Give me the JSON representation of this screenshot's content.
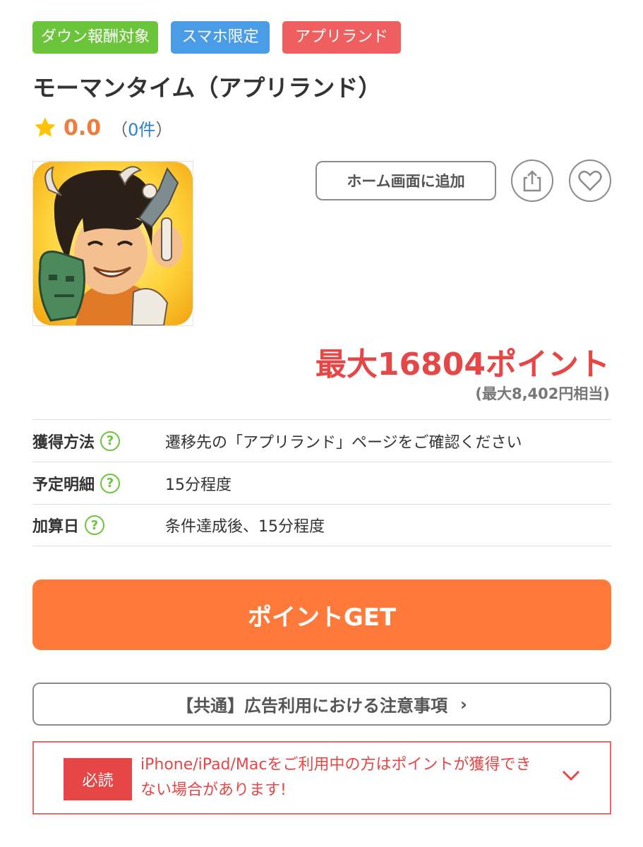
{
  "tags": [
    {
      "label": "ダウン報酬対象",
      "color": "#6bc53b"
    },
    {
      "label": "スマホ限定",
      "color": "#4a9ce6"
    },
    {
      "label": "アプリランド",
      "color": "#ef5f5f"
    }
  ],
  "title": "モーマンタイム（アプリランド）",
  "rating": {
    "value": "0.0",
    "count_open": "（",
    "count": "0件",
    "count_close": "）",
    "icon": "star-icon"
  },
  "actions": {
    "add_home_label": "ホーム画面に追加",
    "share_icon": "share-icon",
    "favorite_icon": "heart-icon"
  },
  "points": {
    "main": "最大16804ポイント",
    "sub": "(最大8,402円相当)"
  },
  "info": [
    {
      "label": "獲得方法",
      "value": "遷移先の「アプリランド」ページをご確認ください"
    },
    {
      "label": "予定明細",
      "value": "15分程度"
    },
    {
      "label": "加算日",
      "value": "条件達成後、15分程度"
    }
  ],
  "help_icon_glyph": "?",
  "get_button_label": "ポイントGET",
  "notice_label": "【共通】広告利用における注意事項",
  "notice_chevron": "›",
  "must_read": {
    "badge": "必読",
    "text": "iPhone/iPad/Macをご利用中の方はポイントが獲得できない場合があります!"
  },
  "colors": {
    "accent": "#ff7a3a",
    "points": "#e64646",
    "green": "#6bc53b",
    "link": "#2e7fd1"
  }
}
